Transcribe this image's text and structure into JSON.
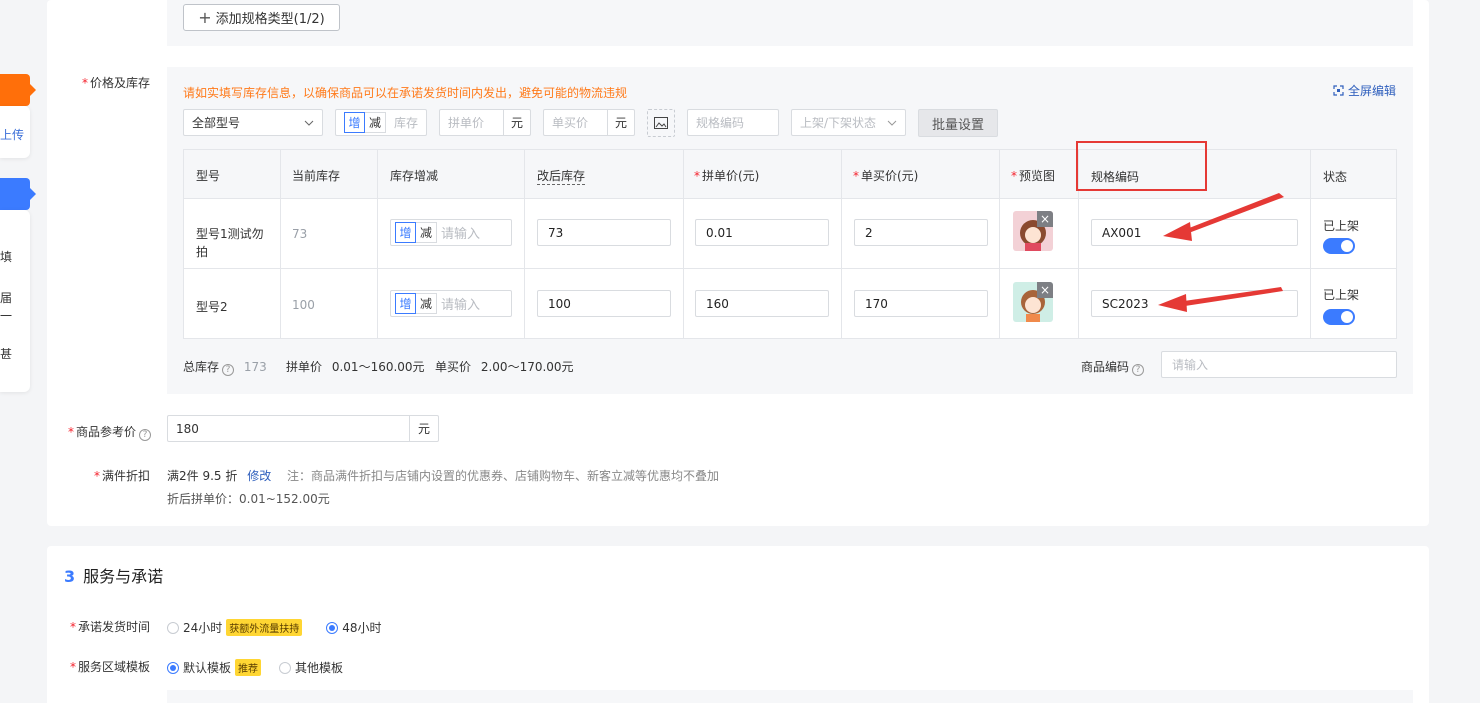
{
  "left_panel": {
    "item_upload": "上传",
    "text_1": "填",
    "text_2": "届",
    "text_3": "一",
    "text_4": "甚"
  },
  "spec": {
    "add_spec_label": "添加规格类型(1/2)"
  },
  "price_stock": {
    "label": "价格及库存",
    "notice": "请如实填写库存信息，以确保商品可以在承诺发货时间内发出，避免可能的物流违规",
    "fullscreen_label": "全屏编辑",
    "toolbar": {
      "model_select": "全部型号",
      "inc": "增",
      "dec": "减",
      "stock_placeholder": "库存",
      "group_price_placeholder": "拼单价",
      "unit": "元",
      "single_price_placeholder": "单买价",
      "spec_code_placeholder": "规格编码",
      "status_placeholder": "上架/下架状态",
      "batch_button": "批量设置"
    },
    "columns": [
      "型号",
      "当前库存",
      "库存增减",
      "改后库存",
      "拼单价(元)",
      "单买价(元)",
      "预览图",
      "规格编码",
      "状态"
    ],
    "rows": [
      {
        "model": "型号1测试勿拍",
        "current_stock": "73",
        "inc": "增",
        "dec": "减",
        "delta_placeholder": "请输入",
        "new_stock": "73",
        "group_price": "0.01",
        "single_price": "2",
        "spec_code": "AX001",
        "status": "已上架"
      },
      {
        "model": "型号2",
        "current_stock": "100",
        "inc": "增",
        "dec": "减",
        "delta_placeholder": "请输入",
        "new_stock": "100",
        "group_price": "160",
        "single_price": "170",
        "spec_code": "SC2023",
        "status": "已上架"
      }
    ],
    "summary": {
      "total_stock_label": "总库存",
      "total_stock": "173",
      "group_price_label": "拼单价",
      "group_price_range": "0.01～160.00元",
      "single_price_label": "单买价",
      "single_price_range": "2.00～170.00元",
      "product_code_label": "商品编码",
      "product_code_placeholder": "请输入"
    }
  },
  "ref_price": {
    "label": "商品参考价",
    "value": "180",
    "unit": "元"
  },
  "discount": {
    "label": "满件折扣",
    "value": "满2件 9.5 折",
    "edit": "修改",
    "note": "注：商品满件折扣与店铺内设置的优惠券、店铺购物车、新客立减等优惠均不叠加",
    "after": "折后拼单价：0.01~152.00元"
  },
  "service": {
    "num": "3",
    "title": "服务与承诺",
    "ship_label": "承诺发货时间",
    "ship_opt1": "24小时",
    "ship_badge": "获额外流量扶持",
    "ship_opt2": "48小时",
    "area_label": "服务区域模板",
    "area_opt1": "默认模板",
    "area_badge": "推荐",
    "area_opt2": "其他模板"
  },
  "colors": {
    "accent": "#3b7bff",
    "notice": "#ff7a1a",
    "annotation": "#e53935"
  }
}
